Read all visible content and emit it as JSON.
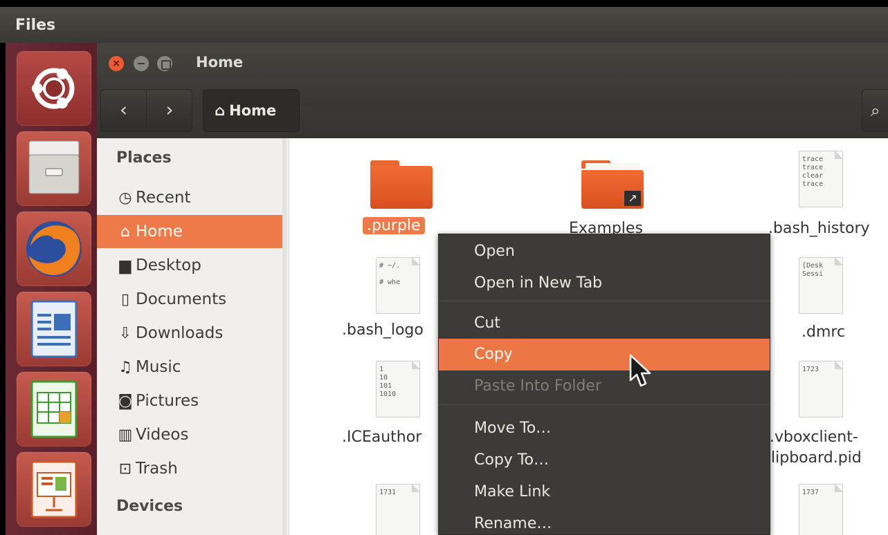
{
  "top_panel": {
    "title": "Files"
  },
  "launcher": {
    "items": [
      {
        "name": "ubuntu-dash-icon"
      },
      {
        "name": "files-app-icon"
      },
      {
        "name": "firefox-icon"
      },
      {
        "name": "libreoffice-writer-icon"
      },
      {
        "name": "libreoffice-calc-icon"
      },
      {
        "name": "libreoffice-impress-icon"
      }
    ]
  },
  "window": {
    "title": "Home",
    "close_glyph": "×"
  },
  "toolbar": {
    "back_glyph": "‹",
    "forward_glyph": "›",
    "path_label": "Home",
    "home_glyph": "⌂",
    "search_glyph": "⌕"
  },
  "sidebar": {
    "places_header": "Places",
    "items": [
      {
        "label": "Recent",
        "icon": "clock-icon",
        "glyph": "◷"
      },
      {
        "label": "Home",
        "icon": "home-icon",
        "glyph": "⌂"
      },
      {
        "label": "Desktop",
        "icon": "folder-icon",
        "glyph": "▆"
      },
      {
        "label": "Documents",
        "icon": "document-icon",
        "glyph": "▯"
      },
      {
        "label": "Downloads",
        "icon": "download-icon",
        "glyph": "⇩"
      },
      {
        "label": "Music",
        "icon": "music-icon",
        "glyph": "♫"
      },
      {
        "label": "Pictures",
        "icon": "camera-icon",
        "glyph": "◙"
      },
      {
        "label": "Videos",
        "icon": "film-icon",
        "glyph": "▥"
      },
      {
        "label": "Trash",
        "icon": "trash-icon",
        "glyph": "⊡"
      }
    ],
    "devices_header": "Devices"
  },
  "files": [
    {
      "name": ".purple",
      "type": "folder"
    },
    {
      "name": "Examples",
      "type": "folder-link"
    },
    {
      "name": ".bash_history",
      "type": "text",
      "preview": "trace\ntrace\nclear\ntrace"
    },
    {
      "name": ".bash_logo",
      "type": "text",
      "preview": "# ~/.\n\n# whe"
    },
    {
      "name": ".dmrc",
      "type": "text",
      "preview": "[Desk\nSessi"
    },
    {
      "name": ".ICEauthor",
      "type": "text",
      "preview": "1\n10\n101\n1010"
    },
    {
      "name": ".vboxclient-",
      "name2": "lipboard.pid",
      "type": "text",
      "preview": "1723"
    },
    {
      "name": "",
      "type": "text",
      "preview": "1731"
    },
    {
      "name": "",
      "type": "text",
      "preview": "1737"
    }
  ],
  "context_menu": {
    "items": [
      {
        "label": "Open"
      },
      {
        "label": "Open in New Tab"
      },
      {
        "label": "Cut"
      },
      {
        "label": "Copy"
      },
      {
        "label": "Paste Into Folder"
      },
      {
        "label": "Move To…"
      },
      {
        "label": "Copy To…"
      },
      {
        "label": "Make Link"
      },
      {
        "label": "Rename…"
      }
    ]
  },
  "colors": {
    "accent": "#ee7a4a",
    "panel": "#3c3b37",
    "launcher": "#5f2430"
  }
}
